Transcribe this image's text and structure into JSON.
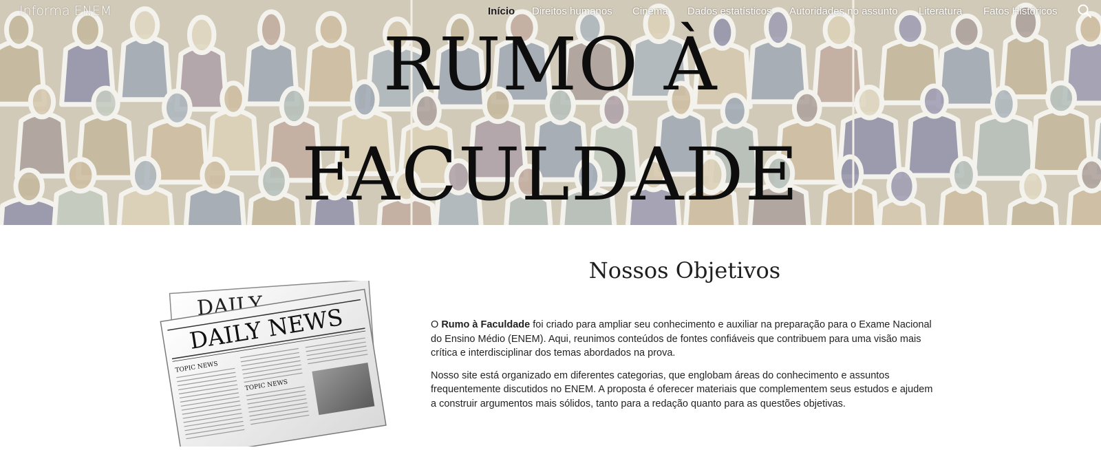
{
  "site": {
    "title": "Informa ENEM"
  },
  "nav": {
    "items": [
      {
        "label": "Início",
        "active": true
      },
      {
        "label": "Direitos humanos",
        "active": false
      },
      {
        "label": "Cinema",
        "active": false
      },
      {
        "label": "Dados estatísticos",
        "active": false
      },
      {
        "label": "Autoridades no assunto",
        "active": false
      },
      {
        "label": "Literatura",
        "active": false
      },
      {
        "label": "Fatos Históricos",
        "active": false
      }
    ],
    "search_icon": "search-icon"
  },
  "hero": {
    "line1": "RUMO À",
    "line2": "FACULDADE"
  },
  "content": {
    "title": "Nossos Objetivos",
    "image": {
      "icon": "newspaper-icon",
      "masthead_back": "DAILY",
      "masthead": "DAILY NEWS",
      "topic1": "TOPIC NEWS",
      "topic2": "TOPIC NEWS"
    },
    "p1_prefix": "O ",
    "p1_bold": "Rumo à Faculdade",
    "p1_rest": " foi criado para ampliar seu conhecimento e auxiliar na preparação para o Exame Nacional do Ensino Médio (ENEM). Aqui, reunimos conteúdos de fontes confiáveis que contribuem para uma visão mais crítica e interdisciplinar dos temas abordados na prova.",
    "p2": "Nosso site está organizado em diferentes categorias, que englobam áreas do conhecimento e assuntos frequentemente discutidos no ENEM. A proposta é oferecer materiais que complementem seus estudos e ajudem a construir argumentos mais sólidos, tanto para a redação quanto para as questões objetivas."
  },
  "colors": {
    "heading": "#0d0d0d",
    "body_text": "#222222",
    "nav_text": "#ffffff"
  }
}
